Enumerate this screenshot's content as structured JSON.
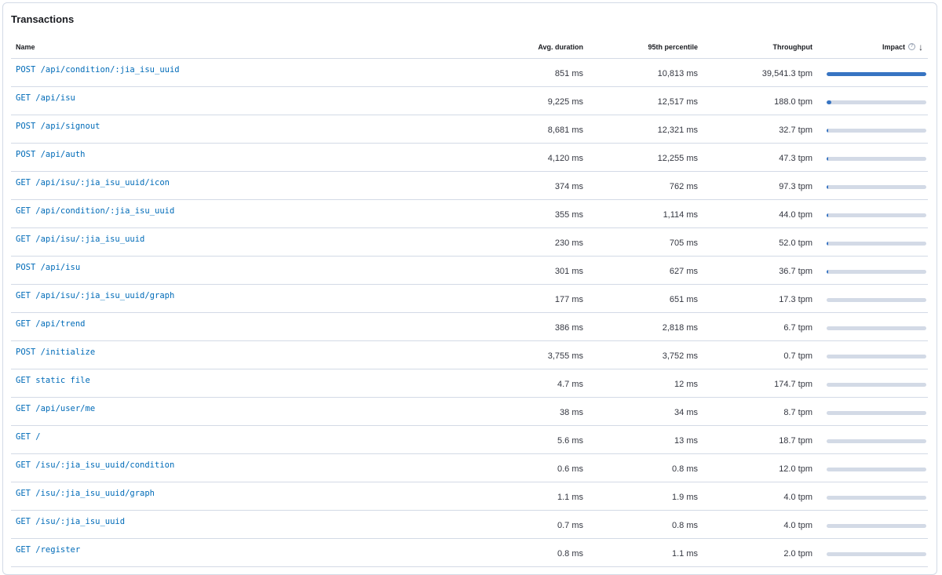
{
  "panel": {
    "title": "Transactions"
  },
  "table": {
    "columns": {
      "name": "Name",
      "avg_duration": "Avg. duration",
      "p95": "95th percentile",
      "throughput": "Throughput",
      "impact": "Impact"
    },
    "sort_icon": "arrow-down-icon",
    "info_icon": "info-icon",
    "accent_color": "#3774c2",
    "link_color": "#006bb8",
    "rows": [
      {
        "name": "POST /api/condition/:jia_isu_uuid",
        "avg": "851 ms",
        "p95": "10,813 ms",
        "tp": "39,541.3 tpm",
        "impact": 100
      },
      {
        "name": "GET /api/isu",
        "avg": "9,225 ms",
        "p95": "12,517 ms",
        "tp": "188.0 tpm",
        "impact": 5
      },
      {
        "name": "POST /api/signout",
        "avg": "8,681 ms",
        "p95": "12,321 ms",
        "tp": "32.7 tpm",
        "impact": 0.8
      },
      {
        "name": "POST /api/auth",
        "avg": "4,120 ms",
        "p95": "12,255 ms",
        "tp": "47.3 tpm",
        "impact": 0.6
      },
      {
        "name": "GET /api/isu/:jia_isu_uuid/icon",
        "avg": "374 ms",
        "p95": "762 ms",
        "tp": "97.3 tpm",
        "impact": 0.3
      },
      {
        "name": "GET /api/condition/:jia_isu_uuid",
        "avg": "355 ms",
        "p95": "1,114 ms",
        "tp": "44.0 tpm",
        "impact": 0.2
      },
      {
        "name": "GET /api/isu/:jia_isu_uuid",
        "avg": "230 ms",
        "p95": "705 ms",
        "tp": "52.0 tpm",
        "impact": 0.1
      },
      {
        "name": "POST /api/isu",
        "avg": "301 ms",
        "p95": "627 ms",
        "tp": "36.7 tpm",
        "impact": 0.1
      },
      {
        "name": "GET /api/isu/:jia_isu_uuid/graph",
        "avg": "177 ms",
        "p95": "651 ms",
        "tp": "17.3 tpm",
        "impact": 0
      },
      {
        "name": "GET /api/trend",
        "avg": "386 ms",
        "p95": "2,818 ms",
        "tp": "6.7 tpm",
        "impact": 0
      },
      {
        "name": "POST /initialize",
        "avg": "3,755 ms",
        "p95": "3,752 ms",
        "tp": "0.7 tpm",
        "impact": 0
      },
      {
        "name": "GET static file",
        "avg": "4.7 ms",
        "p95": "12 ms",
        "tp": "174.7 tpm",
        "impact": 0
      },
      {
        "name": "GET /api/user/me",
        "avg": "38 ms",
        "p95": "34 ms",
        "tp": "8.7 tpm",
        "impact": 0
      },
      {
        "name": "GET /",
        "avg": "5.6 ms",
        "p95": "13 ms",
        "tp": "18.7 tpm",
        "impact": 0
      },
      {
        "name": "GET /isu/:jia_isu_uuid/condition",
        "avg": "0.6 ms",
        "p95": "0.8 ms",
        "tp": "12.0 tpm",
        "impact": 0
      },
      {
        "name": "GET /isu/:jia_isu_uuid/graph",
        "avg": "1.1 ms",
        "p95": "1.9 ms",
        "tp": "4.0 tpm",
        "impact": 0
      },
      {
        "name": "GET /isu/:jia_isu_uuid",
        "avg": "0.7 ms",
        "p95": "0.8 ms",
        "tp": "4.0 tpm",
        "impact": 0
      },
      {
        "name": "GET /register",
        "avg": "0.8 ms",
        "p95": "1.1 ms",
        "tp": "2.0 tpm",
        "impact": 0
      }
    ]
  }
}
